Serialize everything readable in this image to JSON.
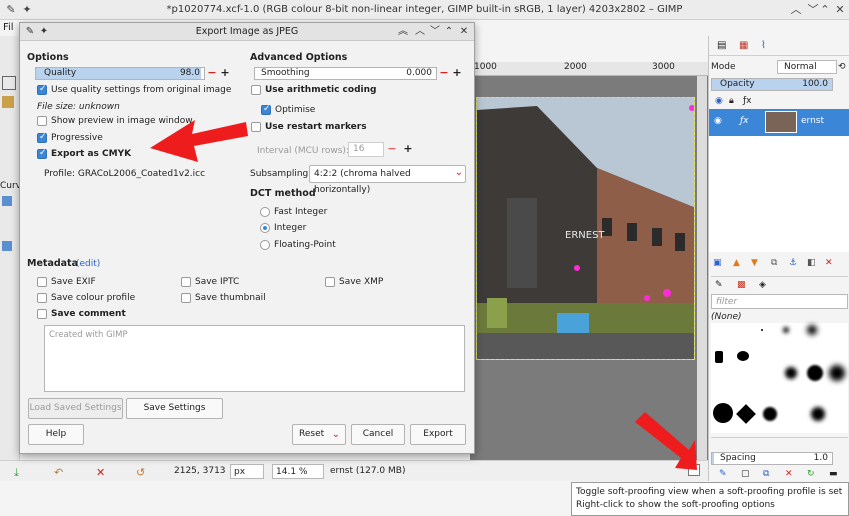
{
  "window": {
    "title": "*p1020774.xcf-1.0 (RGB colour 8-bit non-linear integer, GIMP built-in sRGB, 1 layer) 4203x2802 – GIMP",
    "menu_fragment": "Fil",
    "left_strip_labels": [
      "Curv"
    ]
  },
  "ruler": {
    "labels": [
      "1000",
      "2000",
      "3000"
    ]
  },
  "statusbar": {
    "coords": "2125, 3713",
    "unit": "px",
    "zoom": "14.1 %",
    "layer_info": "ernst (127.0 MB)"
  },
  "right_panel": {
    "mode_label": "Mode",
    "mode_value": "Normal",
    "opacity_label": "Opacity",
    "opacity_value": "100.0",
    "opacity_fraction": 1.0,
    "layer_name": "ernst",
    "filter_placeholder": "filter",
    "brush_set": "(None)",
    "spacing_label": "Spacing",
    "spacing_value": "1.0"
  },
  "tooltip": {
    "line1": "Toggle soft-proofing view when a soft-proofing profile is set",
    "line2": "Right-click to show the soft-proofing options"
  },
  "dialog": {
    "title": "Export Image as JPEG",
    "options_header": "Options",
    "quality_label": "Quality",
    "quality_value": "98.0",
    "quality_fraction": 0.98,
    "use_quality_label": "Use quality settings from original image",
    "use_quality_checked": true,
    "file_size_label": "File size: unknown",
    "show_preview_label": "Show preview in image window",
    "show_preview_checked": false,
    "progressive_label": "Progressive",
    "progressive_checked": true,
    "export_cmyk_label": "Export as CMYK",
    "export_cmyk_checked": true,
    "profile_label": "Profile: GRACoL2006_Coated1v2.icc",
    "advanced_header": "Advanced Options",
    "smoothing_label": "Smoothing",
    "smoothing_value": "0.000",
    "arith_label": "Use arithmetic coding",
    "arith_checked": false,
    "optimise_label": "Optimise",
    "optimise_checked": true,
    "restart_label": "Use restart markers",
    "restart_checked": false,
    "interval_label": "Interval (MCU rows):",
    "interval_value": "16",
    "subsampling_label": "Subsampling",
    "subsampling_value": "4:2:2 (chroma halved horizontally)",
    "dct_header": "DCT method",
    "dct_options": [
      "Fast Integer",
      "Integer",
      "Floating-Point"
    ],
    "dct_selected": "Integer",
    "metadata_header": "Metadata",
    "metadata_edit": "(edit)",
    "save_exif": "Save EXIF",
    "save_iptc": "Save IPTC",
    "save_xmp": "Save XMP",
    "save_colour_profile": "Save colour profile",
    "save_thumbnail": "Save thumbnail",
    "save_comment": "Save comment",
    "comment_text": "Created with GIMP",
    "load_settings": "Load Saved Settings",
    "save_settings": "Save Settings",
    "help": "Help",
    "reset": "Reset",
    "cancel": "Cancel",
    "export": "Export"
  },
  "colors": {
    "accent": "#3b86d6",
    "arrow": "#ee1c1c",
    "selection_marker": "#e7e34a"
  }
}
